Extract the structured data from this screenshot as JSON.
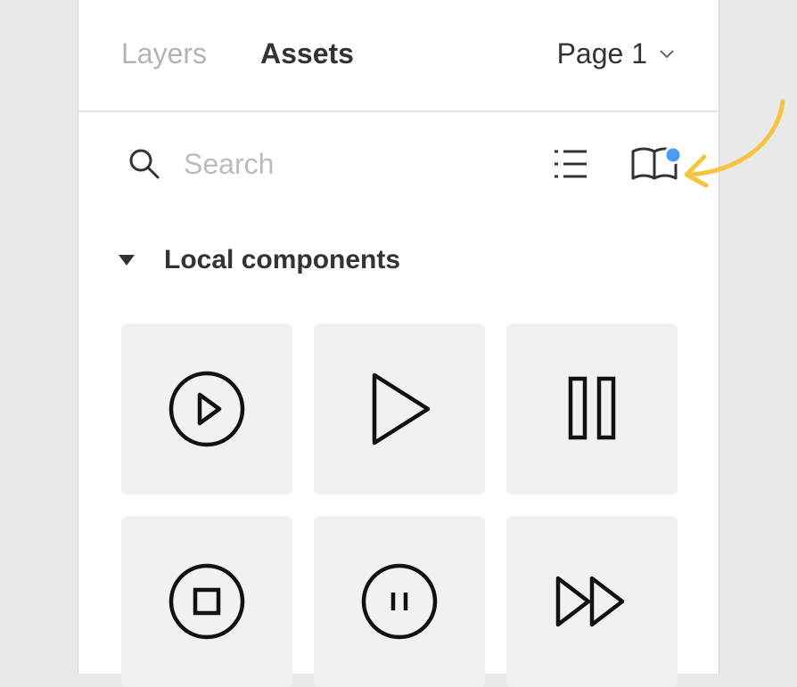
{
  "header": {
    "tabs": [
      {
        "label": "Layers",
        "active": false
      },
      {
        "label": "Assets",
        "active": true
      }
    ],
    "page_selector": {
      "label": "Page 1",
      "icon": "chevron-down-icon"
    }
  },
  "toolbar": {
    "search": {
      "placeholder": "Search",
      "value": "",
      "icon": "search-icon"
    },
    "list_view_icon": "list-view-icon",
    "library_icon": "open-book-icon",
    "library_notification_color": "#4a9cf5"
  },
  "section": {
    "title": "Local components",
    "expanded": true,
    "components": [
      {
        "icon": "play-circle-icon"
      },
      {
        "icon": "play-icon"
      },
      {
        "icon": "pause-icon"
      },
      {
        "icon": "stop-circle-icon"
      },
      {
        "icon": "pause-circle-icon"
      },
      {
        "icon": "fast-forward-icon"
      }
    ]
  },
  "colors": {
    "annotation_arrow": "#f5c542",
    "panel_background": "#ffffff",
    "canvas_background": "#e9e9e9",
    "tile_background": "#f1f1f1"
  }
}
